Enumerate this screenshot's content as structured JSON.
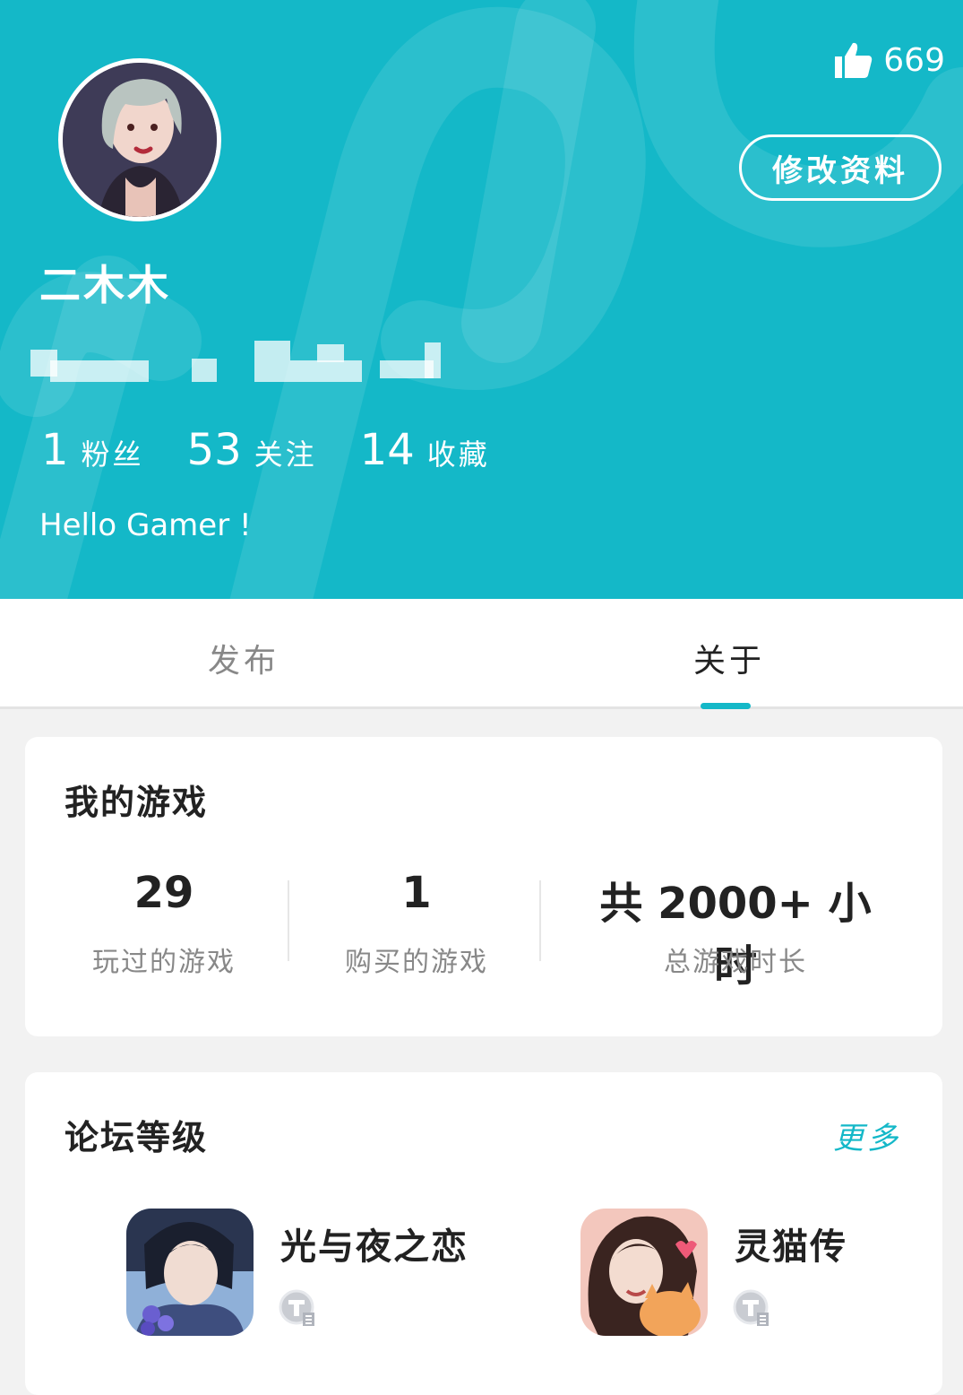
{
  "header": {
    "username": "二木木",
    "likes": "669",
    "edit_button": "修改资料",
    "stats": [
      {
        "value": "1",
        "label": "粉丝"
      },
      {
        "value": "53",
        "label": "关注"
      },
      {
        "value": "14",
        "label": "收藏"
      }
    ],
    "bio": "Hello Gamer !",
    "accent_color": "#14b8c8"
  },
  "tabs": [
    {
      "label": "发布",
      "active": false
    },
    {
      "label": "关于",
      "active": true
    }
  ],
  "my_games": {
    "title": "我的游戏",
    "stats": [
      {
        "value": "29",
        "label": "玩过的游戏"
      },
      {
        "value": "1",
        "label": "购买的游戏"
      },
      {
        "value": "共 2000+ 小时",
        "label": "总游戏时长"
      }
    ]
  },
  "forum_level": {
    "title": "论坛等级",
    "more": "更多",
    "games": [
      {
        "name": "光与夜之恋",
        "icon": "game-icon-guangyuye"
      },
      {
        "name": "灵猫传",
        "icon": "game-icon-lingmaozhuan"
      }
    ]
  }
}
